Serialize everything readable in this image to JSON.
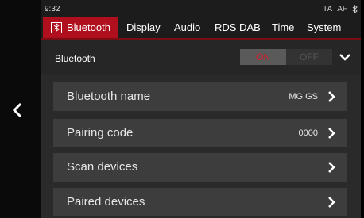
{
  "status": {
    "time": "9:32",
    "ta": "TA",
    "af": "AF"
  },
  "tabs": [
    {
      "label": "Bluetooth",
      "active": true
    },
    {
      "label": "Display",
      "active": false
    },
    {
      "label": "Audio",
      "active": false
    },
    {
      "label": "RDS DAB",
      "active": false
    },
    {
      "label": "Time",
      "active": false
    },
    {
      "label": "System",
      "active": false
    }
  ],
  "header": {
    "label": "Bluetooth",
    "toggle_on": "ON",
    "toggle_off": "OFF",
    "toggle_state": "on"
  },
  "rows": [
    {
      "label": "Bluetooth name",
      "value": "MG GS"
    },
    {
      "label": "Pairing code",
      "value": "0000"
    },
    {
      "label": "Scan devices",
      "value": ""
    },
    {
      "label": "Paired devices",
      "value": ""
    }
  ],
  "colors": {
    "accent": "#b00f1e",
    "on_text": "#d01b2a"
  },
  "icons": {
    "back": "chevron-left-icon",
    "expand": "chevron-down-icon",
    "bluetooth": "bluetooth-icon",
    "row": "chevron-right-icon"
  }
}
